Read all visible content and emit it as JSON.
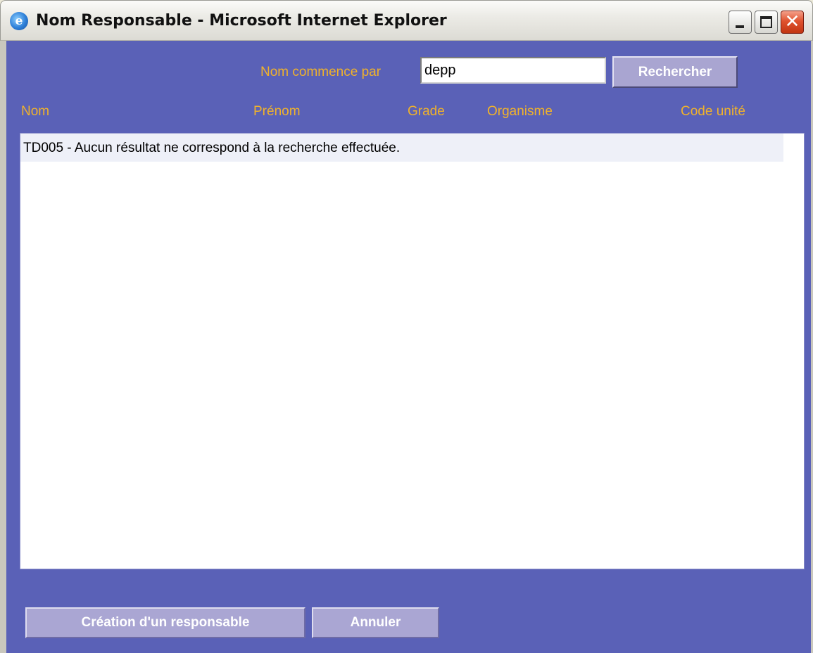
{
  "window": {
    "title": "Nom Responsable - Microsoft Internet Explorer",
    "app_icon": "internet-explorer-icon",
    "controls": {
      "minimize": "minimize-icon",
      "maximize": "maximize-icon",
      "close": "close-icon"
    },
    "close_glyph": "✕"
  },
  "search": {
    "label": "Nom commence par",
    "value": "depp",
    "button_label": "Rechercher"
  },
  "table": {
    "columns": [
      "Nom",
      "Prénom",
      "Grade",
      "Organisme",
      "Code unité"
    ],
    "message": "TD005 - Aucun résultat ne correspond à la recherche effectuée."
  },
  "footer": {
    "create_label": "Création d'un responsable",
    "cancel_label": "Annuler"
  },
  "colors": {
    "background": "#5a61b7",
    "header_text": "#f0b22b",
    "button_face": "#a9a5d1"
  }
}
